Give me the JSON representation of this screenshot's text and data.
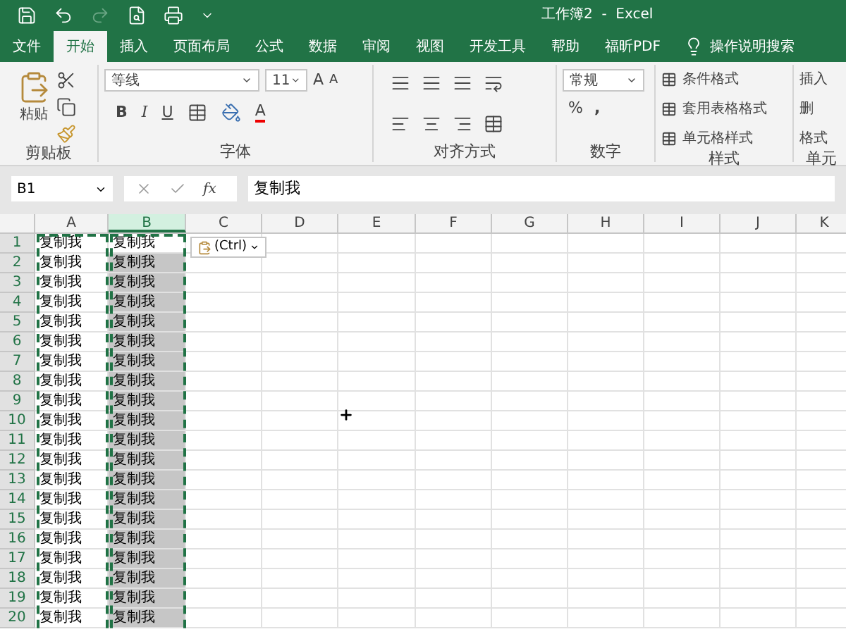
{
  "title_bar": {
    "title": "工作簿2  -  Excel"
  },
  "ribbon_tabs": [
    {
      "label": "文件",
      "selected": false
    },
    {
      "label": "开始",
      "selected": true
    },
    {
      "label": "插入",
      "selected": false
    },
    {
      "label": "页面布局",
      "selected": false
    },
    {
      "label": "公式",
      "selected": false
    },
    {
      "label": "数据",
      "selected": false
    },
    {
      "label": "审阅",
      "selected": false
    },
    {
      "label": "视图",
      "selected": false
    },
    {
      "label": "开发工具",
      "selected": false
    },
    {
      "label": "帮助",
      "selected": false
    },
    {
      "label": "福昕PDF",
      "selected": false
    }
  ],
  "tell_me": "操作说明搜索",
  "clipboard": {
    "paste": "粘贴",
    "group": "剪贴板"
  },
  "font": {
    "font_name": "等线",
    "font_size": "11",
    "bold": "B",
    "italic": "I",
    "underline": "U",
    "grow_font": "A",
    "shrink_font": "A",
    "font_color": "A",
    "group": "字体"
  },
  "alignment": {
    "group": "对齐方式"
  },
  "number": {
    "format": "常规",
    "percent": "%",
    "comma": ",",
    "group": "数字"
  },
  "styles": {
    "items": [
      "条件格式",
      "套用表格格式",
      "单元格样式"
    ],
    "group": "样式"
  },
  "cells": {
    "items": [
      "插入",
      "删",
      "格式"
    ],
    "group": "单元"
  },
  "formula_bar": {
    "name_box": "B1",
    "fx": "fx",
    "value": "复制我"
  },
  "columns": [
    {
      "label": "A",
      "selected": false
    },
    {
      "label": "B",
      "selected": true
    },
    {
      "label": "C",
      "selected": false
    },
    {
      "label": "D",
      "selected": false
    },
    {
      "label": "E",
      "selected": false
    },
    {
      "label": "F",
      "selected": false
    },
    {
      "label": "G",
      "selected": false
    },
    {
      "label": "H",
      "selected": false
    },
    {
      "label": "I",
      "selected": false
    },
    {
      "label": "J",
      "selected": false
    },
    {
      "label": "K",
      "selected": false
    }
  ],
  "paste_options": "(Ctrl)",
  "rows": [
    {
      "label": "1",
      "selected": true,
      "cells": [
        {
          "text": "复制我",
          "selected": false
        },
        {
          "text": "复制我",
          "selected": false
        }
      ]
    },
    {
      "label": "2",
      "selected": true,
      "cells": [
        {
          "text": "复制我",
          "selected": false
        },
        {
          "text": "复制我",
          "selected": true
        }
      ]
    },
    {
      "label": "3",
      "selected": true,
      "cells": [
        {
          "text": "复制我",
          "selected": false
        },
        {
          "text": "复制我",
          "selected": true
        }
      ]
    },
    {
      "label": "4",
      "selected": true,
      "cells": [
        {
          "text": "复制我",
          "selected": false
        },
        {
          "text": "复制我",
          "selected": true
        }
      ]
    },
    {
      "label": "5",
      "selected": true,
      "cells": [
        {
          "text": "复制我",
          "selected": false
        },
        {
          "text": "复制我",
          "selected": true
        }
      ]
    },
    {
      "label": "6",
      "selected": true,
      "cells": [
        {
          "text": "复制我",
          "selected": false
        },
        {
          "text": "复制我",
          "selected": true
        }
      ]
    },
    {
      "label": "7",
      "selected": true,
      "cells": [
        {
          "text": "复制我",
          "selected": false
        },
        {
          "text": "复制我",
          "selected": true
        }
      ]
    },
    {
      "label": "8",
      "selected": true,
      "cells": [
        {
          "text": "复制我",
          "selected": false
        },
        {
          "text": "复制我",
          "selected": true
        }
      ]
    },
    {
      "label": "9",
      "selected": true,
      "cells": [
        {
          "text": "复制我",
          "selected": false
        },
        {
          "text": "复制我",
          "selected": true
        }
      ]
    },
    {
      "label": "10",
      "selected": true,
      "cells": [
        {
          "text": "复制我",
          "selected": false
        },
        {
          "text": "复制我",
          "selected": true
        }
      ]
    },
    {
      "label": "11",
      "selected": true,
      "cells": [
        {
          "text": "复制我",
          "selected": false
        },
        {
          "text": "复制我",
          "selected": true
        }
      ]
    },
    {
      "label": "12",
      "selected": true,
      "cells": [
        {
          "text": "复制我",
          "selected": false
        },
        {
          "text": "复制我",
          "selected": true
        }
      ]
    },
    {
      "label": "13",
      "selected": true,
      "cells": [
        {
          "text": "复制我",
          "selected": false
        },
        {
          "text": "复制我",
          "selected": true
        }
      ]
    },
    {
      "label": "14",
      "selected": true,
      "cells": [
        {
          "text": "复制我",
          "selected": false
        },
        {
          "text": "复制我",
          "selected": true
        }
      ]
    },
    {
      "label": "15",
      "selected": true,
      "cells": [
        {
          "text": "复制我",
          "selected": false
        },
        {
          "text": "复制我",
          "selected": true
        }
      ]
    },
    {
      "label": "16",
      "selected": true,
      "cells": [
        {
          "text": "复制我",
          "selected": false
        },
        {
          "text": "复制我",
          "selected": true
        }
      ]
    },
    {
      "label": "17",
      "selected": true,
      "cells": [
        {
          "text": "复制我",
          "selected": false
        },
        {
          "text": "复制我",
          "selected": true
        }
      ]
    },
    {
      "label": "18",
      "selected": true,
      "cells": [
        {
          "text": "复制我",
          "selected": false
        },
        {
          "text": "复制我",
          "selected": true
        }
      ]
    },
    {
      "label": "19",
      "selected": true,
      "cells": [
        {
          "text": "复制我",
          "selected": false
        },
        {
          "text": "复制我",
          "selected": true
        }
      ]
    },
    {
      "label": "20",
      "selected": true,
      "cells": [
        {
          "text": "复制我",
          "selected": false
        },
        {
          "text": "复制我",
          "selected": true
        }
      ]
    }
  ]
}
